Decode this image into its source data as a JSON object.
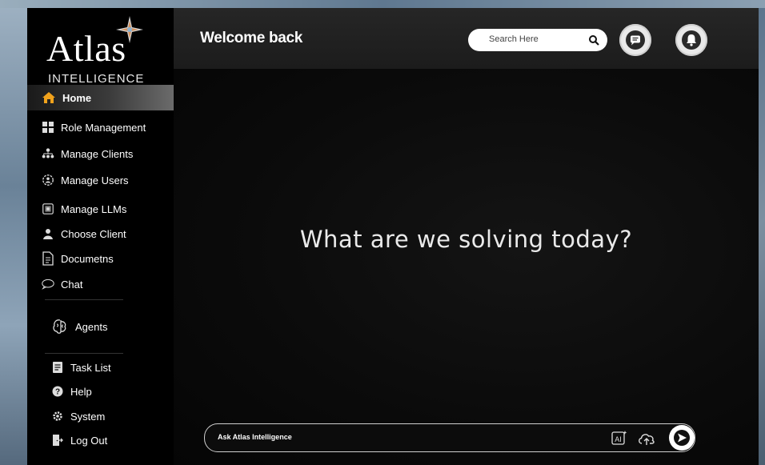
{
  "brand": {
    "name": "Atlas",
    "subtitle": "INTELLIGENCE",
    "star_color": "#d8925a"
  },
  "sidebar": {
    "home": {
      "label": "Home",
      "icon": "home-icon",
      "color": "#f0a21c"
    },
    "items": [
      {
        "label": "Role Management",
        "icon": "grid-icon"
      },
      {
        "label": "Manage Clients",
        "icon": "org-chart-icon"
      },
      {
        "label": "Manage Users",
        "icon": "users-gear-icon"
      },
      {
        "label": "Manage LLMs",
        "icon": "llm-chip-icon"
      },
      {
        "label": "Choose Client",
        "icon": "person-icon"
      },
      {
        "label": "Documetns",
        "icon": "document-icon"
      },
      {
        "label": "Chat",
        "icon": "chat-bubble-icon"
      },
      {
        "label": "Agents",
        "icon": "brain-icon"
      },
      {
        "label": "Task List",
        "icon": "clipboard-icon"
      },
      {
        "label": "Help",
        "icon": "help-icon"
      },
      {
        "label": "System",
        "icon": "gear-icon"
      },
      {
        "label": "Log Out",
        "icon": "logout-icon"
      }
    ]
  },
  "header": {
    "title": "Welcome back",
    "search_placeholder": "Search Here",
    "icons": [
      "chat-icon",
      "bell-icon",
      "avatar"
    ]
  },
  "main": {
    "headline": "What are we solving today?",
    "ask_placeholder": "Ask Atlas Intelligence",
    "ask_icons": [
      "ai-icon",
      "upload-cloud-icon",
      "send-icon"
    ]
  }
}
